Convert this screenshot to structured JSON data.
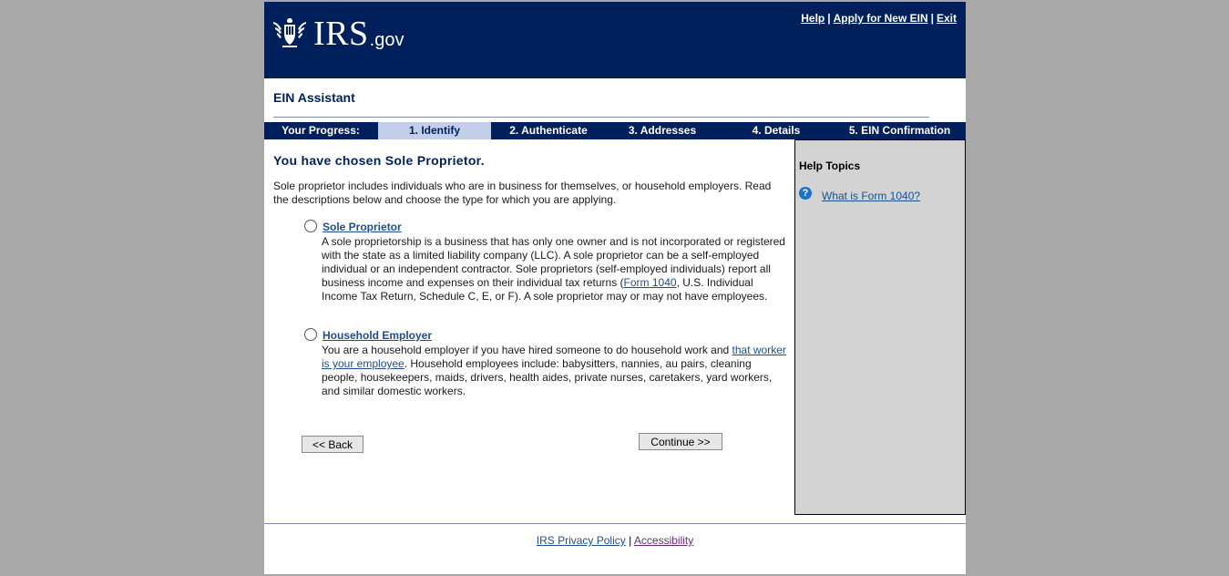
{
  "header": {
    "logo_text": "IRS",
    "logo_suffix": ".gov",
    "links": {
      "help": "Help",
      "apply": "Apply for New EIN",
      "exit": "Exit"
    },
    "separator": "|"
  },
  "app_title": "EIN Assistant",
  "progress": {
    "label": "Your Progress:",
    "steps": [
      "1. Identify",
      "2. Authenticate",
      "3. Addresses",
      "4. Details",
      "5. EIN Confirmation"
    ],
    "active_step": "1. Identify"
  },
  "main": {
    "heading": "You have chosen Sole Proprietor.",
    "intro": "Sole proprietor includes individuals who are in business for themselves, or household employers. Read the descriptions below and choose the type for which you are applying.",
    "options": [
      {
        "label": "Sole Proprietor",
        "desc_part1": "A sole proprietorship is a business that has only one owner and is not incorporated or registered with the state as a limited liability company (LLC). A sole proprietor can be a self-employed individual or an independent contractor. Sole proprietors (self-employed individuals) report all business income and expenses on their individual tax returns (",
        "desc_link": "Form 1040",
        "desc_part2": ", U.S. Individual Income Tax Return, Schedule C, E, or F). A sole proprietor may or may not have employees."
      },
      {
        "label": "Household Employer",
        "desc_part1": "You are a household employer if you have hired someone to do household work and ",
        "desc_link": "that worker is your employee",
        "desc_part2": ". Household employees include: babysitters, nannies, au pairs, cleaning people, housekeepers, maids, drivers, health aides, private nurses, caretakers, yard workers, and similar domestic workers."
      }
    ],
    "back_button": "<< Back",
    "continue_button": "Continue >>"
  },
  "sidebar": {
    "title": "Help Topics",
    "icon": "question-circle-icon",
    "link": "What is Form 1040?"
  },
  "footer": {
    "privacy": "IRS Privacy Policy",
    "separator": "|",
    "accessibility": "Accessibility"
  },
  "colors": {
    "brand_navy": "#00205b",
    "active_step": "#c3cfe9",
    "sidebar_bg": "#d3d3d3",
    "link": "#1f4e8c",
    "visited_link": "#6b2a7a"
  }
}
